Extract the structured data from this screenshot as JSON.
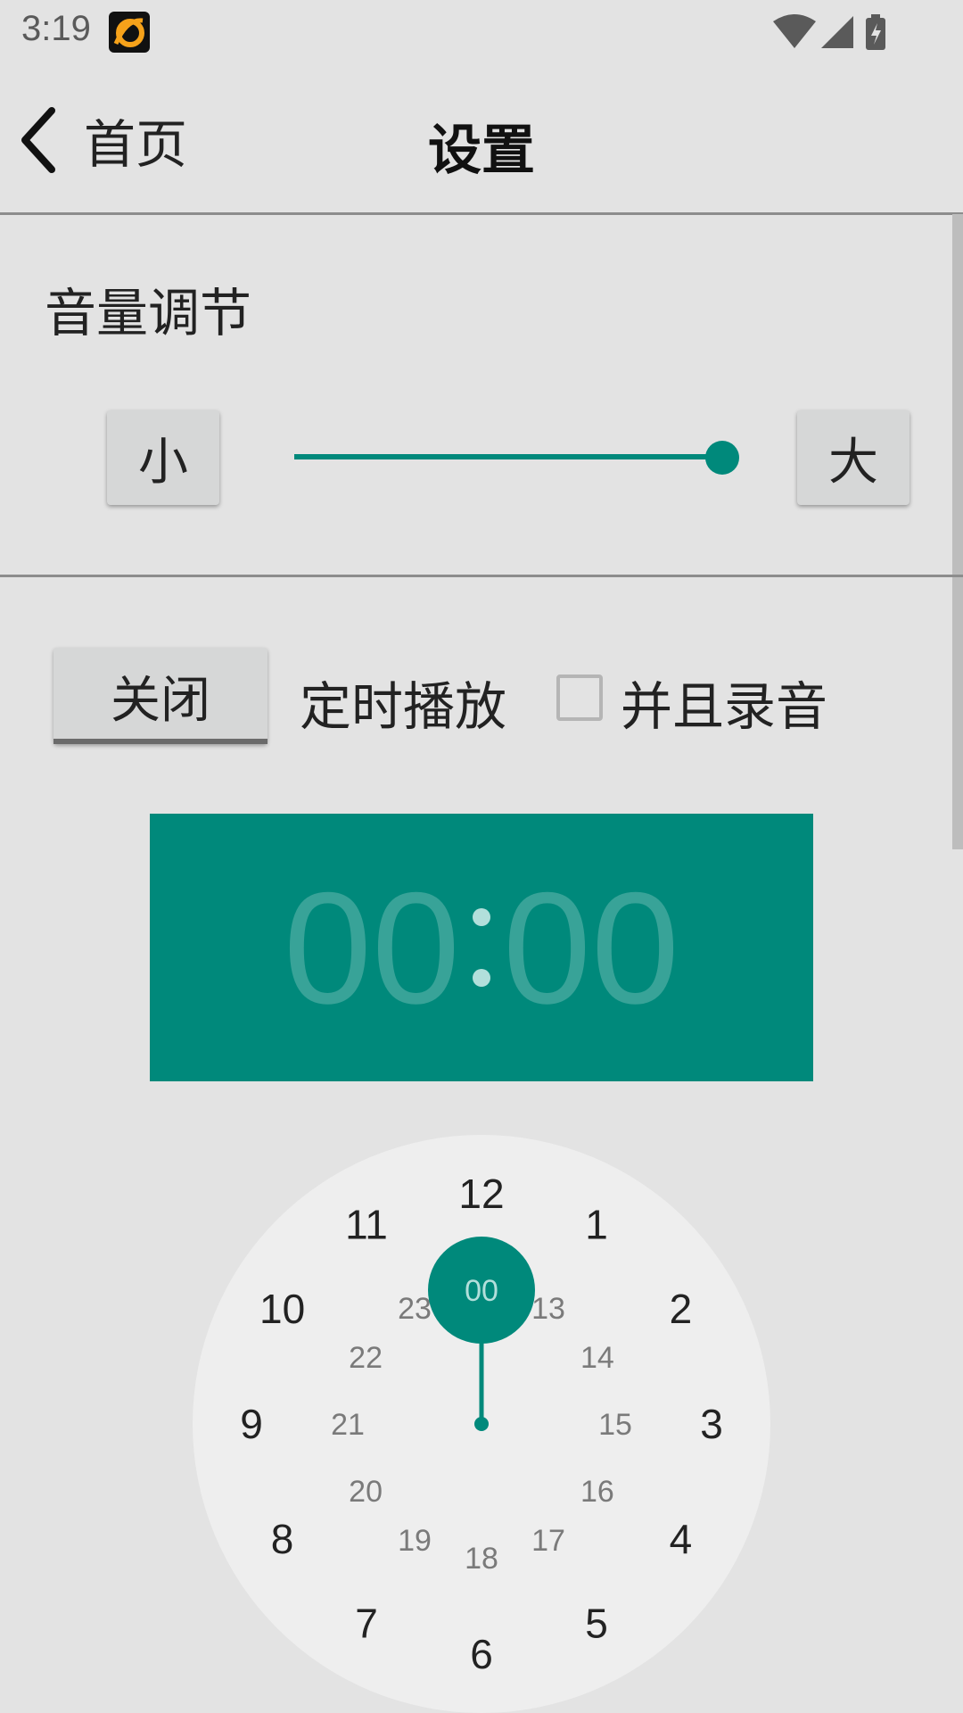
{
  "status_bar": {
    "time": "3:19"
  },
  "header": {
    "back_label": "首页",
    "title": "设置"
  },
  "volume": {
    "title": "音量调节",
    "decrease_label": "小",
    "increase_label": "大",
    "level_percent": 100
  },
  "schedule": {
    "toggle_label": "关闭",
    "timed_play_label": "定时播放",
    "record_checked": false,
    "record_label": "并且录音"
  },
  "timer": {
    "hours": "00",
    "minutes": "00",
    "selected_hour_label": "00",
    "outer_numbers": [
      "12",
      "1",
      "2",
      "3",
      "4",
      "5",
      "6",
      "7",
      "8",
      "9",
      "10",
      "11"
    ],
    "inner_numbers": [
      "00",
      "13",
      "14",
      "15",
      "16",
      "17",
      "18",
      "19",
      "20",
      "21",
      "22",
      "23"
    ]
  },
  "colors": {
    "accent": "#00897b",
    "background": "#e3e3e3",
    "clock_face": "#eeeeee"
  }
}
